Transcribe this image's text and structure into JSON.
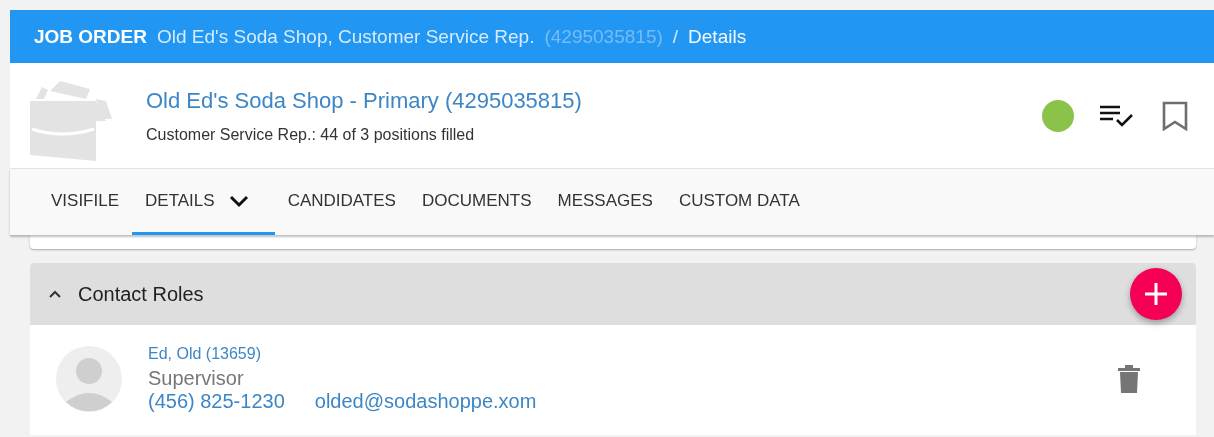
{
  "breadcrumb": {
    "section": "JOB ORDER",
    "record": "Old Ed's Soda Shop, Customer Service Rep.",
    "record_id": "(4295035815)",
    "separator": "/",
    "page": "Details"
  },
  "job": {
    "title": "Old Ed's Soda Shop - Primary (4295035815)",
    "subtitle": "Customer Service Rep.: 44 of 3 positions filled"
  },
  "tabs": [
    {
      "label": "VISIFILE",
      "selected": false,
      "has_menu": false
    },
    {
      "label": "DETAILS",
      "selected": true,
      "has_menu": true
    },
    {
      "label": "CANDIDATES",
      "selected": false,
      "has_menu": false
    },
    {
      "label": "DOCUMENTS",
      "selected": false,
      "has_menu": false
    },
    {
      "label": "MESSAGES",
      "selected": false,
      "has_menu": false
    },
    {
      "label": "CUSTOM DATA",
      "selected": false,
      "has_menu": false
    }
  ],
  "contact_roles": {
    "title": "Contact Roles",
    "expanded": true,
    "contacts": [
      {
        "name": "Ed, Old (13659)",
        "role": "Supervisor",
        "phone": "(456) 825-1230",
        "email": "olded@sodashoppe.xom"
      }
    ]
  }
}
